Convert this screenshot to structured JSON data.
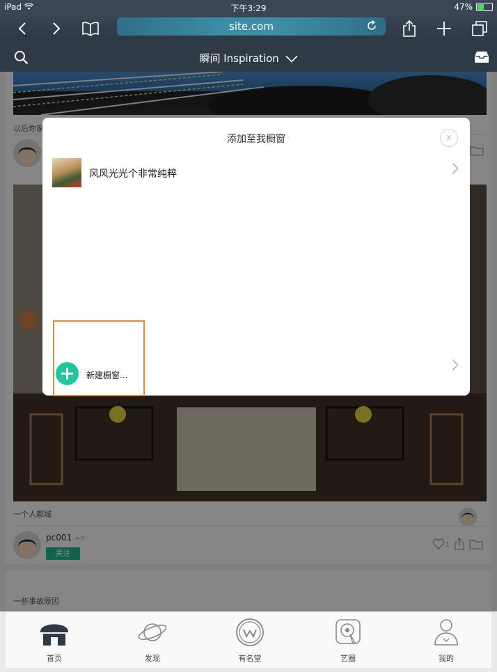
{
  "status_bar": {
    "device": "iPad",
    "time": "下午3:29",
    "battery_text": "47%",
    "battery_level": 0.47
  },
  "browser": {
    "url": "site.com"
  },
  "app_header": {
    "title": "瞬间 Inspiration"
  },
  "feed": {
    "cards": [
      {
        "caption": "以后你家"
      },
      {
        "caption": "一个人都城",
        "username": "pc001",
        "count": "+0",
        "follow_label": "关注",
        "like_count": "1"
      },
      {
        "caption": "一些事故原因"
      }
    ]
  },
  "modal": {
    "title": "添加至我橱窗",
    "close_label": "x",
    "showcases": [
      {
        "name": "风风光光个非常纯粹"
      }
    ],
    "new_showcase_label": "新建橱窗..."
  },
  "tab_bar": {
    "tabs": [
      {
        "label": "首页"
      },
      {
        "label": "发现"
      },
      {
        "label": "有名堂"
      },
      {
        "label": "艺圈"
      },
      {
        "label": "我的"
      }
    ]
  },
  "colors": {
    "accent": "#1fc7a0",
    "highlight": "#e8893a",
    "header_bg": "#2f3a47"
  }
}
